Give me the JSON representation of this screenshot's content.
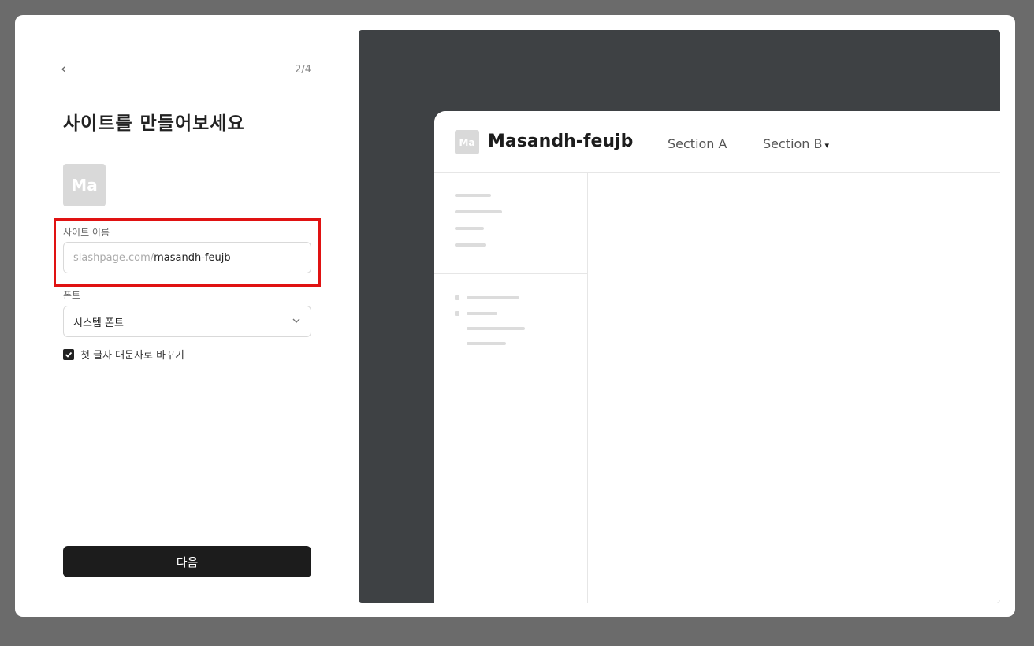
{
  "wizard": {
    "back_label": "‹",
    "step": "2/4",
    "title": "사이트를 만들어보세요",
    "avatar_text": "Ma",
    "site_name_label": "사이트 이름",
    "site_url_prefix": "slashpage.com/",
    "site_url_value": "masandh-feujb",
    "font_label": "폰트",
    "font_value": "시스템 폰트",
    "capitalize_label": "첫 글자 대문자로 바꾸기",
    "capitalize_checked": true,
    "next_label": "다음"
  },
  "preview": {
    "logo_text": "Ma",
    "site_title": "Masandh-feujb",
    "nav_a": "Section A",
    "nav_b": "Section B"
  },
  "colors": {
    "highlight": "#e01212",
    "primary_button": "#1c1c1c",
    "preview_background": "#3e4144"
  }
}
